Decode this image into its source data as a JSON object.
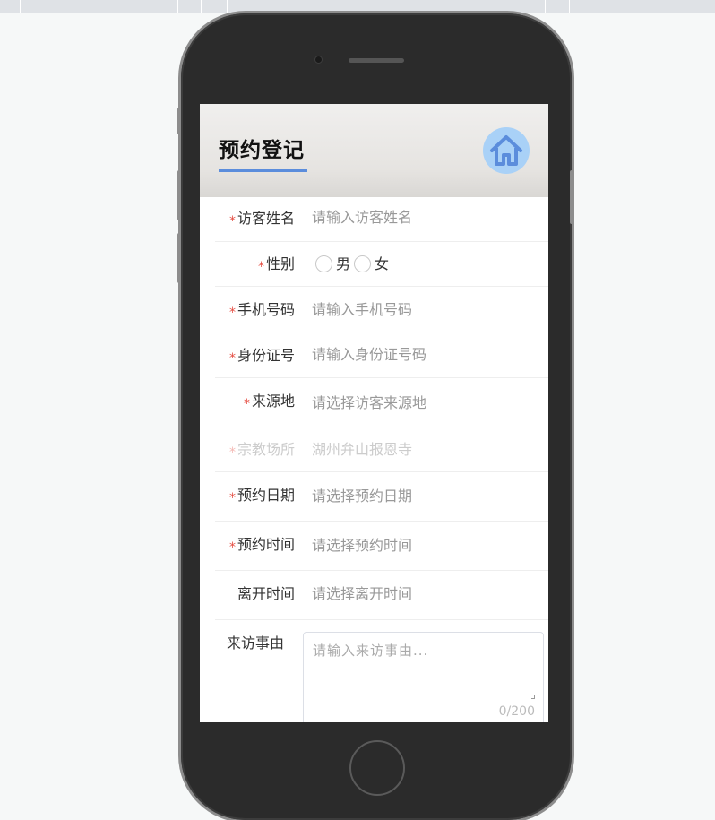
{
  "app": {
    "title": "预约登记"
  },
  "icons": {
    "home": "home-icon",
    "accent": "#5b8ddc",
    "icon_bg": "#a9d1f7"
  },
  "form": {
    "visitor_name": {
      "label": "访客姓名",
      "required": true,
      "placeholder": "请输入访客姓名"
    },
    "gender": {
      "label": "性别",
      "required": true,
      "options": [
        "男",
        "女"
      ]
    },
    "phone": {
      "label": "手机号码",
      "required": true,
      "placeholder": "请输入手机号码"
    },
    "id_number": {
      "label": "身份证号",
      "required": true,
      "placeholder": "请输入身份证号码"
    },
    "origin": {
      "label": "来源地",
      "required": true,
      "placeholder": "请选择访客来源地"
    },
    "venue": {
      "label": "宗教场所",
      "required": true,
      "value": "湖州弁山报恩寺",
      "disabled": true
    },
    "date": {
      "label": "预约日期",
      "required": true,
      "placeholder": "请选择预约日期"
    },
    "time": {
      "label": "预约时间",
      "required": true,
      "placeholder": "请选择预约时间"
    },
    "leave_time": {
      "label": "离开时间",
      "required": false,
      "placeholder": "请选择离开时间"
    },
    "reason": {
      "label": "来访事由",
      "placeholder": "请输入来访事由...",
      "count": "0/200"
    }
  },
  "required_mark": "*"
}
